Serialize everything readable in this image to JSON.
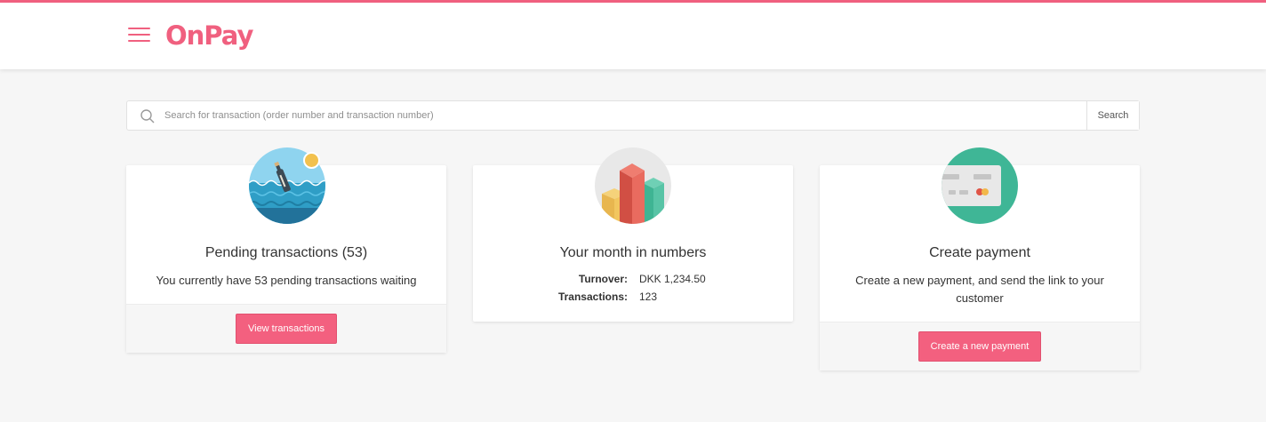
{
  "header": {
    "logo": "OnPay",
    "accent_color": "#f0607f",
    "menu_icon": "hamburger-menu-icon"
  },
  "search": {
    "placeholder": "Search for transaction (order number and transaction number)",
    "button_label": "Search",
    "icon": "search-icon"
  },
  "cards": {
    "pending": {
      "illustration": "message-in-bottle-icon",
      "title": "Pending transactions (53)",
      "text": "You currently have 53 pending transactions waiting",
      "button_label": "View transactions"
    },
    "month": {
      "illustration": "bar-chart-icon",
      "title": "Your month in numbers",
      "turnover_label": "Turnover:",
      "turnover_value": "DKK 1,234.50",
      "transactions_label": "Transactions:",
      "transactions_value": "123"
    },
    "payment": {
      "illustration": "credit-card-icon",
      "title": "Create payment",
      "text": "Create a new payment, and send the link to your customer",
      "button_label": "Create a new payment"
    }
  }
}
